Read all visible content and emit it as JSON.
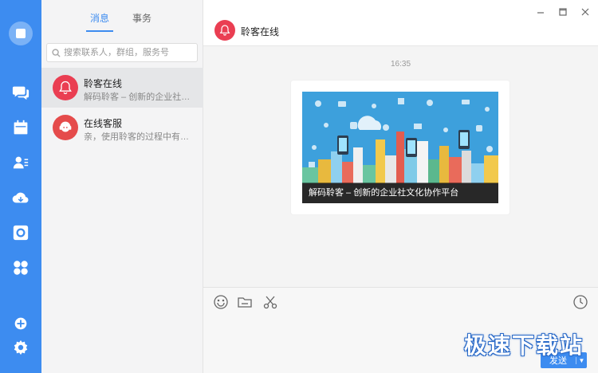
{
  "tabs": [
    {
      "label": "消息",
      "active": true
    },
    {
      "label": "事务",
      "active": false
    }
  ],
  "search": {
    "placeholder": "搜索联系人，群组，服务号"
  },
  "conversations": [
    {
      "name": "聆客在线",
      "preview": "解码聆客 – 创新的企业社文化...",
      "avatar_color": "#ea3e52",
      "icon": "bell-icon",
      "selected": true
    },
    {
      "name": "在线客服",
      "preview": "亲，使用聆客的过程中有什么...",
      "avatar_color": "#e54b4b",
      "icon": "support-agent-icon",
      "selected": false
    }
  ],
  "chat": {
    "title": "聆客在线",
    "timestamp": "16:35",
    "card_caption": "解码聆客 – 创新的企业社文化协作平台"
  },
  "rail_icons": [
    "chat-icon",
    "calendar-icon",
    "contacts-icon",
    "cloud-icon",
    "sphere-icon",
    "apps-icon",
    "add-icon",
    "settings-icon"
  ],
  "window_controls": [
    "minimize-icon",
    "maximize-icon",
    "close-icon"
  ],
  "toolbar": [
    "emoji-icon",
    "folder-icon",
    "scissors-icon",
    "history-icon"
  ],
  "send": {
    "label": "发送"
  },
  "watermark": "极速下载站",
  "colors": {
    "accent": "#3d8cf0",
    "brand_red": "#ea3e52"
  }
}
